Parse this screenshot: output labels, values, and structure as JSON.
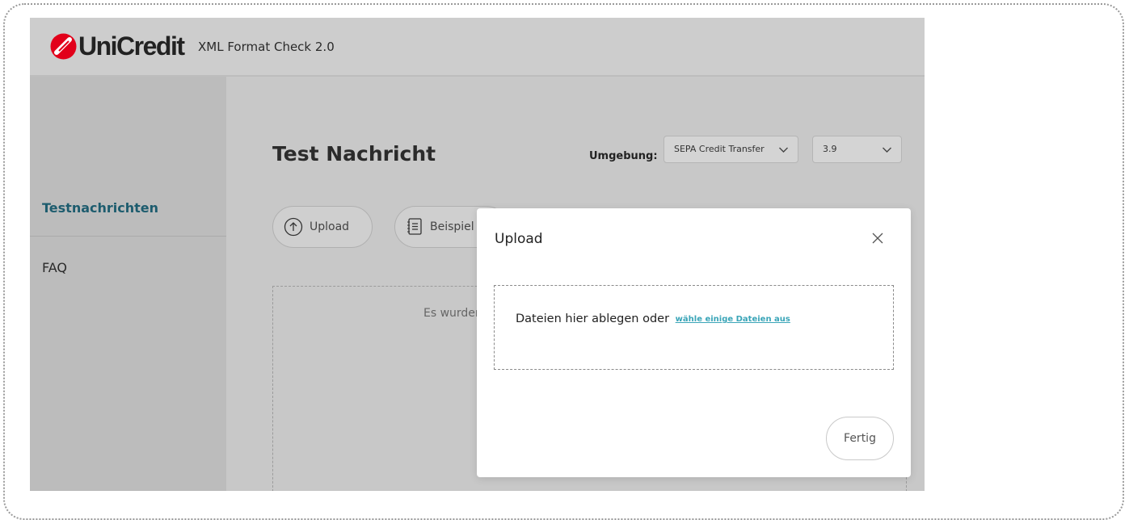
{
  "header": {
    "brand": "UniCredit",
    "app_title": "XML Format Check 2.0",
    "brand_color": "#e2001a"
  },
  "sidebar": {
    "items": [
      {
        "label": "Testnachrichten",
        "active": true
      },
      {
        "label": "FAQ",
        "active": false
      }
    ],
    "active_color": "#1d5c6e"
  },
  "main": {
    "title": "Test Nachricht",
    "environment_label": "Umgebung:",
    "environment_select": {
      "value": "SEPA Credit Transfer",
      "icon": "chevron-down-icon"
    },
    "version_select": {
      "value": "3.9",
      "icon": "chevron-down-icon"
    },
    "actions": [
      {
        "label": "Upload",
        "icon": "upload-arrow-icon"
      },
      {
        "label": "Beispiel",
        "icon": "document-list-icon"
      }
    ],
    "dropzone_text": "Es wurden"
  },
  "modal": {
    "title": "Upload",
    "close_icon": "close-icon",
    "dropzone_text": "Dateien hier ablegen oder",
    "dropzone_link": "wähle einige Dateien aus",
    "link_color": "#3aa5b8",
    "done_label": "Fertig"
  }
}
